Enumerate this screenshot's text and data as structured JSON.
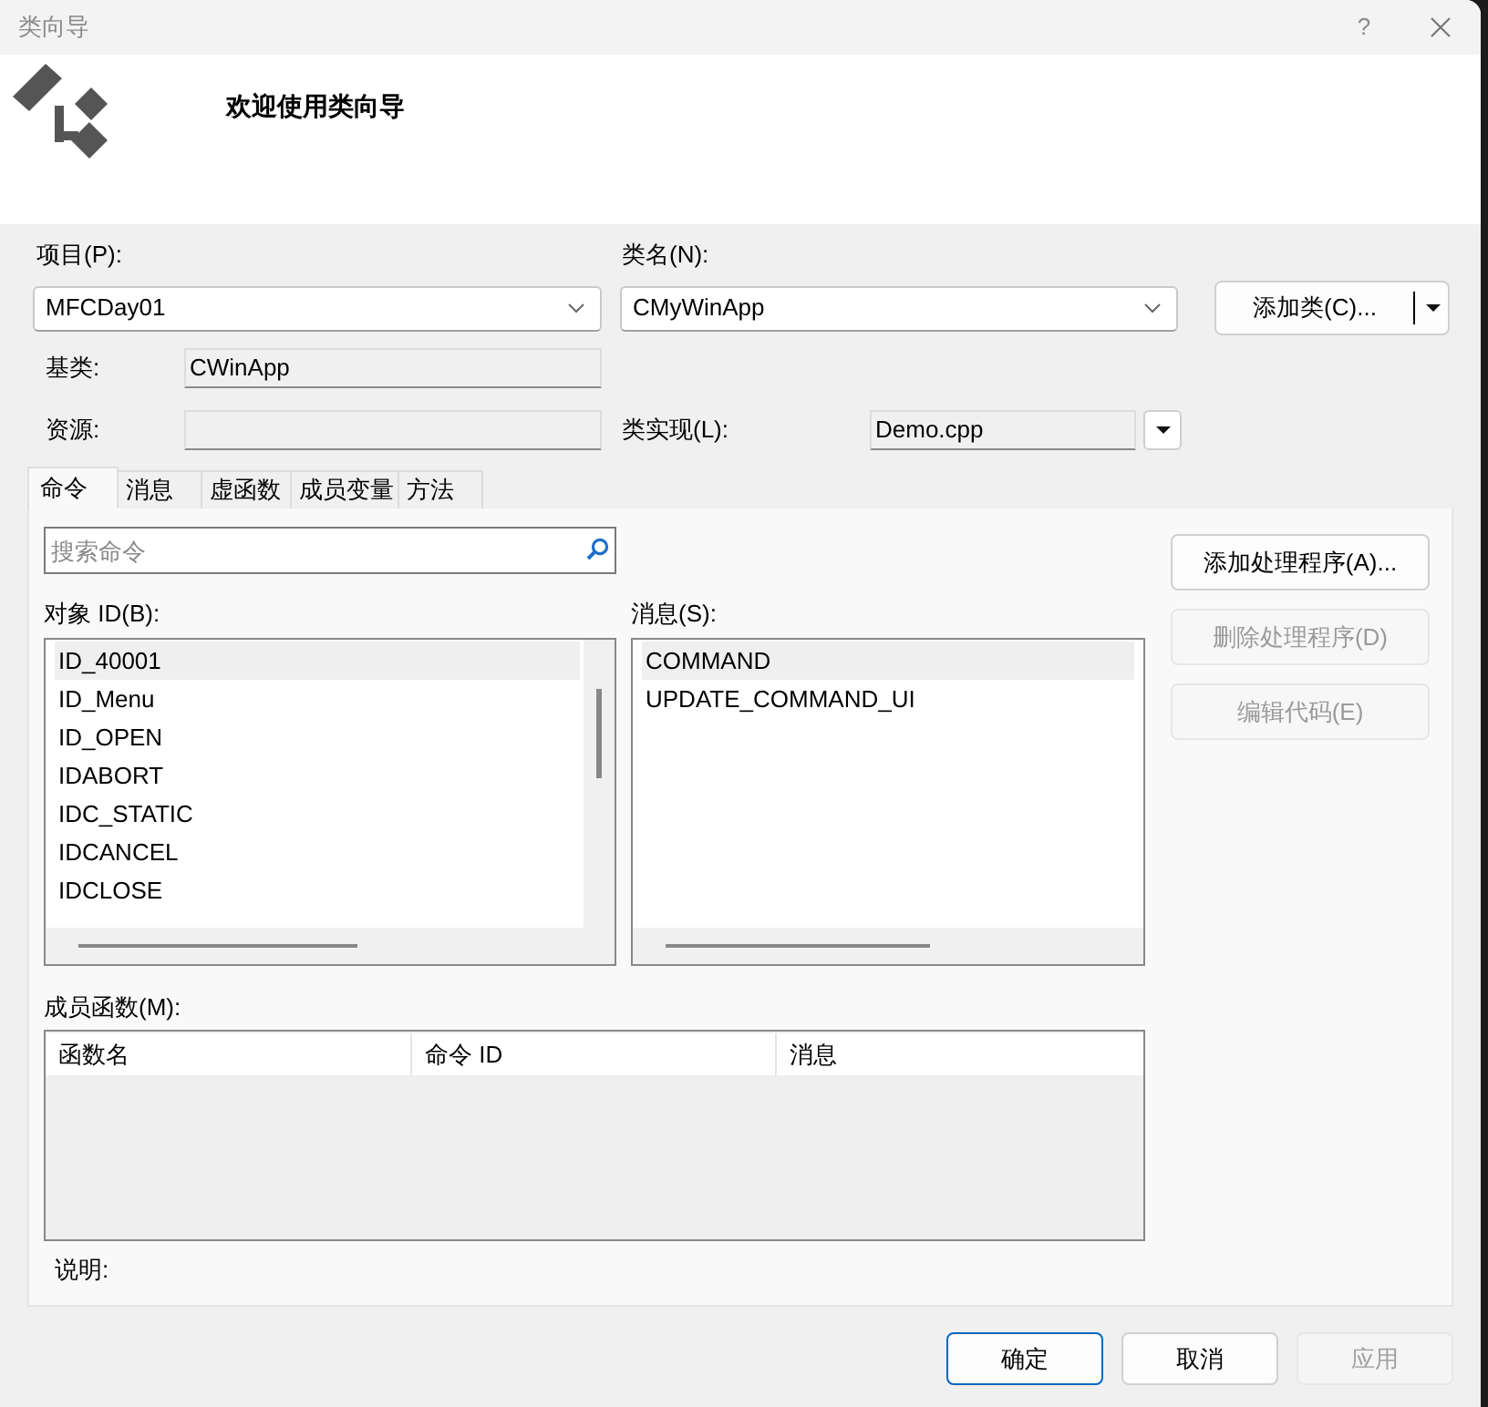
{
  "window": {
    "title": "类向导",
    "help_label": "?"
  },
  "header": {
    "heading": "欢迎使用类向导"
  },
  "project": {
    "label": "项目(P):",
    "value": "MFCDay01"
  },
  "class_name": {
    "label": "类名(N):",
    "value": "CMyWinApp"
  },
  "add_class_button": {
    "label": "添加类(C)..."
  },
  "base_class": {
    "label": "基类:",
    "value": "CWinApp"
  },
  "resource": {
    "label": "资源:"
  },
  "class_impl": {
    "label": "类实现(L):",
    "value": "Demo.cpp"
  },
  "tabs": [
    {
      "label": "命令",
      "selected": true
    },
    {
      "label": "消息",
      "selected": false
    },
    {
      "label": "虚函数",
      "selected": false
    },
    {
      "label": "成员变量",
      "selected": false
    },
    {
      "label": "方法",
      "selected": false
    }
  ],
  "search": {
    "placeholder": "搜索命令"
  },
  "object_ids": {
    "label": "对象 ID(B):",
    "items": [
      {
        "text": "ID_40001",
        "selected": true
      },
      {
        "text": "ID_Menu",
        "selected": false
      },
      {
        "text": "ID_OPEN",
        "selected": false
      },
      {
        "text": "IDABORT",
        "selected": false
      },
      {
        "text": "IDC_STATIC",
        "selected": false
      },
      {
        "text": "IDCANCEL",
        "selected": false
      },
      {
        "text": "IDCLOSE",
        "selected": false
      }
    ]
  },
  "messages": {
    "label": "消息(S):",
    "items": [
      {
        "text": "COMMAND",
        "selected": true
      },
      {
        "text": "UPDATE_COMMAND_UI",
        "selected": false
      }
    ]
  },
  "side_buttons": [
    {
      "label": "添加处理程序(A)...",
      "disabled": false
    },
    {
      "label": "删除处理程序(D)",
      "disabled": true
    },
    {
      "label": "编辑代码(E)",
      "disabled": true
    }
  ],
  "member_functions": {
    "label": "成员函数(M):",
    "columns": [
      "函数名",
      "命令 ID",
      "消息"
    ]
  },
  "description": {
    "label": "说明:"
  },
  "buttons": [
    {
      "label": "确定",
      "default": true,
      "disabled": false
    },
    {
      "label": "取消",
      "default": false,
      "disabled": false
    },
    {
      "label": "应用",
      "default": false,
      "disabled": true
    }
  ]
}
